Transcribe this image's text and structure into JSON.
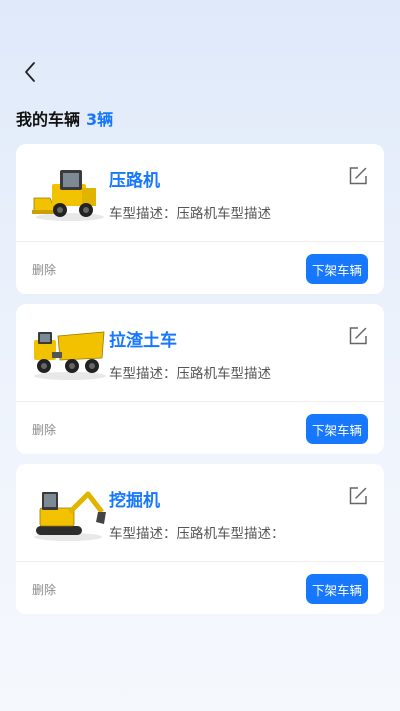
{
  "header": {
    "back_icon": "chevron-left-icon"
  },
  "section": {
    "title": "我的车辆",
    "count": "3辆"
  },
  "vehicles": [
    {
      "name": "压路机",
      "description": "车型描述：压路机车型描述",
      "delete_label": "删除",
      "action_label": "下架车辆",
      "image": "skid-steer-loader"
    },
    {
      "name": "拉渣土车",
      "description": "车型描述：压路机车型描述",
      "delete_label": "删除",
      "action_label": "下架车辆",
      "image": "articulated-dump-truck"
    },
    {
      "name": "挖掘机",
      "description": "车型描述：压路机车型描述：",
      "delete_label": "删除",
      "action_label": "下架车辆",
      "image": "excavator"
    }
  ],
  "colors": {
    "accent": "#1677ff",
    "machine_yellow": "#f2c200"
  }
}
